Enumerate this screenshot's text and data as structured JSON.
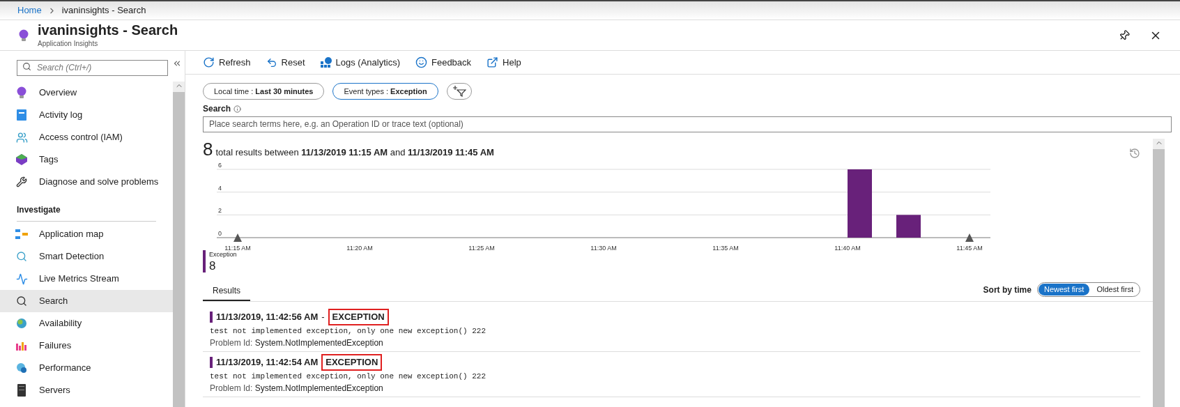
{
  "breadcrumb": [
    {
      "label": "Home",
      "link": true
    },
    {
      "label": "ivaninsights - Search",
      "link": false
    }
  ],
  "header": {
    "title": "ivaninsights - Search",
    "subtitle": "Application Insights"
  },
  "sidebar": {
    "search_placeholder": "Search (Ctrl+/)",
    "items": [
      {
        "label": "Overview",
        "selected": false
      },
      {
        "label": "Activity log",
        "selected": false
      },
      {
        "label": "Access control (IAM)",
        "selected": false
      },
      {
        "label": "Tags",
        "selected": false
      },
      {
        "label": "Diagnose and solve problems",
        "selected": false
      }
    ],
    "sections": [
      {
        "title": "Investigate",
        "items": [
          {
            "label": "Application map",
            "selected": false
          },
          {
            "label": "Smart Detection",
            "selected": false
          },
          {
            "label": "Live Metrics Stream",
            "selected": false
          },
          {
            "label": "Search",
            "selected": true
          },
          {
            "label": "Availability",
            "selected": false
          },
          {
            "label": "Failures",
            "selected": false
          },
          {
            "label": "Performance",
            "selected": false
          },
          {
            "label": "Servers",
            "selected": false
          }
        ]
      }
    ]
  },
  "toolbar": [
    "Refresh",
    "Reset",
    "Logs (Analytics)",
    "Feedback",
    "Help"
  ],
  "filters": [
    {
      "label": "Local time : ",
      "value": "Last 30 minutes",
      "selected": false
    },
    {
      "label": "Event types : ",
      "value": "Exception",
      "selected": true
    }
  ],
  "search": {
    "label": "Search",
    "placeholder": "Place search terms here, e.g. an Operation ID or trace text (optional)"
  },
  "summary": {
    "count": "8",
    "text": "total results between **11/13/2019 11:15 AM** and **11/13/2019 11:45 AM**"
  },
  "chart_data": {
    "type": "bar",
    "categories": [
      "11:15 AM",
      null,
      null,
      null,
      null,
      "11:20 AM",
      null,
      null,
      null,
      null,
      "11:25 AM",
      null,
      null,
      null,
      null,
      "11:30 AM",
      null,
      null,
      null,
      null,
      "11:35 AM",
      null,
      null,
      null,
      null,
      "11:40 AM",
      null,
      null,
      null,
      null,
      "11:45 AM"
    ],
    "series": [
      {
        "name": "Exception",
        "color": "#68217a",
        "values": [
          null,
          null,
          null,
          null,
          null,
          null,
          null,
          null,
          null,
          null,
          null,
          null,
          null,
          null,
          null,
          null,
          null,
          null,
          null,
          null,
          null,
          null,
          null,
          null,
          null,
          6,
          null,
          2,
          null,
          null,
          null
        ]
      }
    ],
    "ylim": [
      0,
      6
    ],
    "yticks": [
      0,
      2,
      4,
      6
    ]
  },
  "legend": [
    {
      "count": "8"
    }
  ],
  "results_tab": {
    "label": "Results",
    "selected": true
  },
  "sort": {
    "label": "Sort by time",
    "options": [
      {
        "label": "Newest first",
        "selected": true
      },
      {
        "label": "Oldest first",
        "selected": false
      }
    ]
  },
  "results": [
    {
      "time": "11/13/2019, 11:42:56 AM",
      "separator": "-",
      "type": "EXCEPTION",
      "message": "test not implemented exception, only one new exception() 222",
      "problem_label": "Problem Id:",
      "problem_id": "System.NotImplementedException",
      "color": "#68217a"
    },
    {
      "time": "11/13/2019, 11:42:54 AM",
      "type": "EXCEPTION",
      "message": "test not implemented exception, only one new exception() 222",
      "problem_label": "Problem Id:",
      "problem_id": "System.NotImplementedException",
      "color": "#68217a"
    }
  ]
}
